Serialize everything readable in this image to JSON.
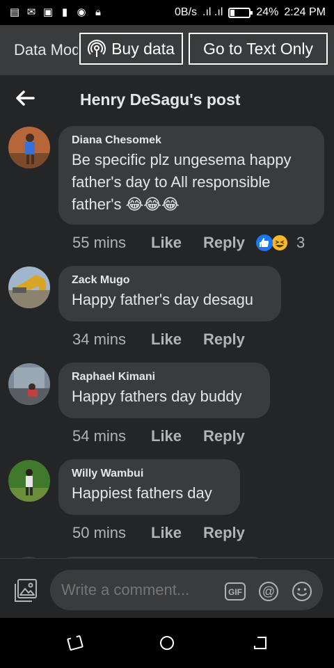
{
  "status_bar": {
    "network_speed": "0B/s",
    "battery_percent": "24%",
    "battery_level": 0.24,
    "time": "2:24 PM"
  },
  "data_bar": {
    "mode_label": "Data Mode",
    "buy_data_label": "Buy data",
    "text_only_label": "Go to Text Only"
  },
  "header": {
    "title": "Henry DeSagu's post"
  },
  "comments": [
    {
      "author": "Diana Chesomek",
      "text": "Be specific plz ungesema happy father's day to All responsible father's 😂😂😂",
      "time": "55 mins",
      "like_label": "Like",
      "reply_label": "Reply",
      "reaction_count": "3"
    },
    {
      "author": "Zack Mugo",
      "text": "Happy father's day desagu",
      "time": "34 mins",
      "like_label": "Like",
      "reply_label": "Reply"
    },
    {
      "author": "Raphael Kimani",
      "text": "Happy fathers day buddy",
      "time": "54 mins",
      "like_label": "Like",
      "reply_label": "Reply"
    },
    {
      "author": "Willy Wambui",
      "text": "Happiest fathers day",
      "time": "50 mins",
      "like_label": "Like",
      "reply_label": "Reply"
    }
  ],
  "composer": {
    "placeholder": "Write a comment...",
    "gif_label": "GIF"
  },
  "colors": {
    "background": "#242526",
    "bubble": "#3a3b3c",
    "text_primary": "#e4e6eb",
    "text_secondary": "#b0b3b8",
    "like_blue": "#1877f2"
  }
}
